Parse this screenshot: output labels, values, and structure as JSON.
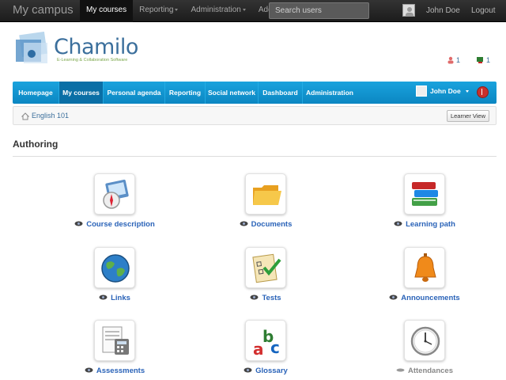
{
  "topbar": {
    "brand": "My campus",
    "nav": [
      {
        "label": "My courses",
        "active": true,
        "dropdown": false
      },
      {
        "label": "Reporting",
        "active": false,
        "dropdown": true
      },
      {
        "label": "Administration",
        "active": false,
        "dropdown": true
      },
      {
        "label": "Add",
        "active": false,
        "dropdown": true
      }
    ],
    "search_placeholder": "Search users",
    "user": "John Doe",
    "logout": "Logout"
  },
  "header": {
    "logo_text": "Chamilo",
    "logo_tagline": "E-Learning & Collaboration Software",
    "notifications": [
      {
        "icon": "users-icon",
        "count": "1"
      },
      {
        "icon": "chat-icon",
        "count": "1"
      }
    ]
  },
  "menu": {
    "items": [
      {
        "label": "Homepage",
        "active": false
      },
      {
        "label": "My courses",
        "active": true
      },
      {
        "label": "Personal agenda",
        "active": false
      },
      {
        "label": "Reporting",
        "active": false
      },
      {
        "label": "Social network",
        "active": false
      },
      {
        "label": "Dashboard",
        "active": false
      },
      {
        "label": "Administration",
        "active": false
      }
    ],
    "user": "John Doe"
  },
  "breadcrumb": {
    "course": "English 101",
    "learner_view": "Learner View"
  },
  "section": {
    "title": "Authoring"
  },
  "tools": [
    {
      "label": "Course description",
      "icon": "course-description-icon",
      "visible": true
    },
    {
      "label": "Documents",
      "icon": "folder-icon",
      "visible": true
    },
    {
      "label": "Learning path",
      "icon": "books-icon",
      "visible": true
    },
    {
      "label": "Links",
      "icon": "globe-icon",
      "visible": true
    },
    {
      "label": "Tests",
      "icon": "quiz-icon",
      "visible": true
    },
    {
      "label": "Announcements",
      "icon": "bell-icon",
      "visible": true
    },
    {
      "label": "Assessments",
      "icon": "calculator-icon",
      "visible": true
    },
    {
      "label": "Glossary",
      "icon": "abc-icon",
      "visible": true
    },
    {
      "label": "Attendances",
      "icon": "clock-icon",
      "visible": false
    }
  ],
  "colors": {
    "menu_blue": "#0b86c2",
    "link_blue": "#2a63b8",
    "topbar": "#1c1c1c"
  }
}
